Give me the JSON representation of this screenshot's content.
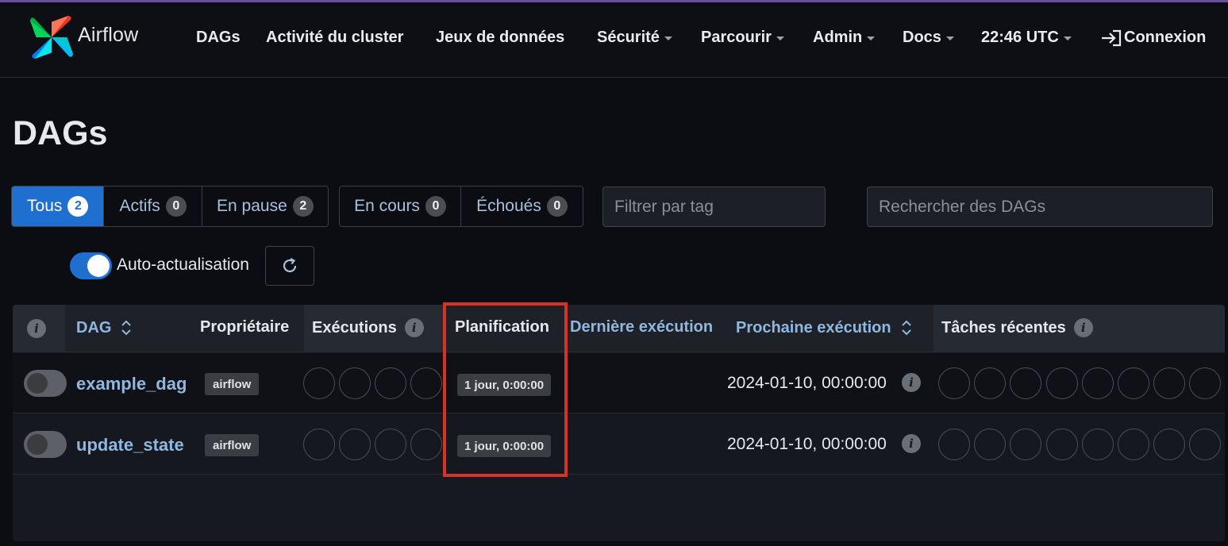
{
  "navbar": {
    "brand": "Airflow",
    "items": [
      {
        "label": "DAGs",
        "dropdown": false
      },
      {
        "label": "Activité du cluster",
        "dropdown": false
      },
      {
        "label": "Jeux de données",
        "dropdown": false
      },
      {
        "label": "Sécurité",
        "dropdown": true
      },
      {
        "label": "Parcourir",
        "dropdown": true
      },
      {
        "label": "Admin",
        "dropdown": true
      },
      {
        "label": "Docs",
        "dropdown": true
      },
      {
        "label": "22:46 UTC",
        "dropdown": true
      }
    ],
    "login": "Connexion"
  },
  "page": {
    "title": "DAGs"
  },
  "filters": {
    "status_group_1": [
      {
        "label": "Tous",
        "count": "2",
        "active": true
      },
      {
        "label": "Actifs",
        "count": "0",
        "active": false
      },
      {
        "label": "En pause",
        "count": "2",
        "active": false
      }
    ],
    "status_group_2": [
      {
        "label": "En cours",
        "count": "0"
      },
      {
        "label": "Échoués",
        "count": "0"
      }
    ],
    "tag_placeholder": "Filtrer par tag",
    "search_placeholder": "Rechercher des DAGs"
  },
  "auto_refresh": {
    "label": "Auto-actualisation",
    "enabled": true
  },
  "table": {
    "headers": {
      "dag": "DAG",
      "owner": "Propriétaire",
      "runs": "Exécutions",
      "schedule": "Planification",
      "last_run": "Dernière exécution",
      "next_run": "Prochaine exécution",
      "recent_tasks": "Tâches récentes"
    },
    "rows": [
      {
        "dag_id": "example_dag",
        "owner": "airflow",
        "schedule": "1 jour, 0:00:00",
        "next_run": "2024-01-10, 00:00:00",
        "paused": true
      },
      {
        "dag_id": "update_state",
        "owner": "airflow",
        "schedule": "1 jour, 0:00:00",
        "next_run": "2024-01-10, 00:00:00",
        "paused": true
      }
    ]
  },
  "colors": {
    "accent": "#1f6fd0",
    "link": "#8fb7e0",
    "highlight": "#d83226",
    "background": "#0b0d12"
  }
}
